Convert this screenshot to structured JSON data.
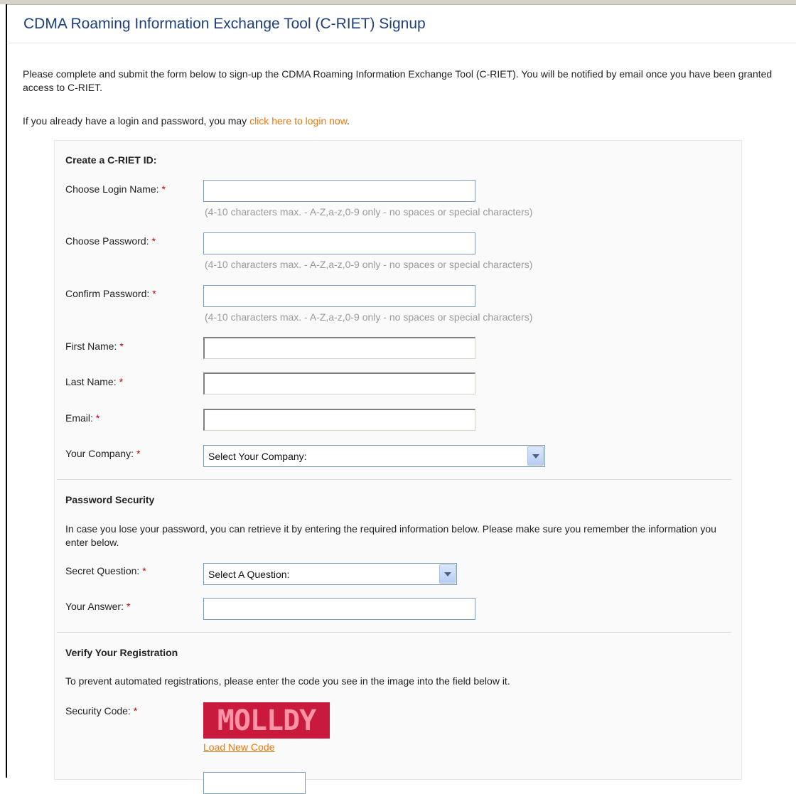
{
  "page": {
    "title": "CDMA Roaming Information Exchange Tool (C-RIET) Signup",
    "intro": "Please complete and submit the form below to sign-up the CDMA Roaming Information Exchange Tool (C-RIET). You will be notified by email once you have been granted access to C-RIET.",
    "login_prefix": "If you already have a login and password, you may ",
    "login_link": "click here to login now",
    "login_suffix": "."
  },
  "colors": {
    "title": "#1f3e7e",
    "link": "#e8790f",
    "required": "#c00000",
    "captcha_bg": "#c91a3e"
  },
  "form": {
    "required_mark": "*",
    "create_section": {
      "heading": "Create a C-RIET ID:",
      "login_label": "Choose Login Name:",
      "password_label": "Choose Password:",
      "confirm_label": "Confirm Password:",
      "first_label": "First Name:",
      "last_label": "Last Name:",
      "email_label": "Email:",
      "company_label": "Your Company:",
      "company_selected": "Select Your Company:",
      "hint": "(4-10 characters max. - A-Z,a-z,0-9 only - no spaces or special characters)"
    },
    "security_section": {
      "heading": "Password Security",
      "description": "In case you lose your password, you can retrieve it by entering the required information below. Please make sure you remember the information you enter below.",
      "question_label": "Secret Question:",
      "question_selected": "Select A Question:",
      "answer_label": "Your Answer:"
    },
    "verify_section": {
      "heading": "Verify Your Registration",
      "description": "To prevent automated registrations, please enter the code you see in the image into the field below it.",
      "code_label": "Security Code:",
      "captcha_text": "MOLLDY",
      "new_code_link": "Load New Code"
    }
  }
}
